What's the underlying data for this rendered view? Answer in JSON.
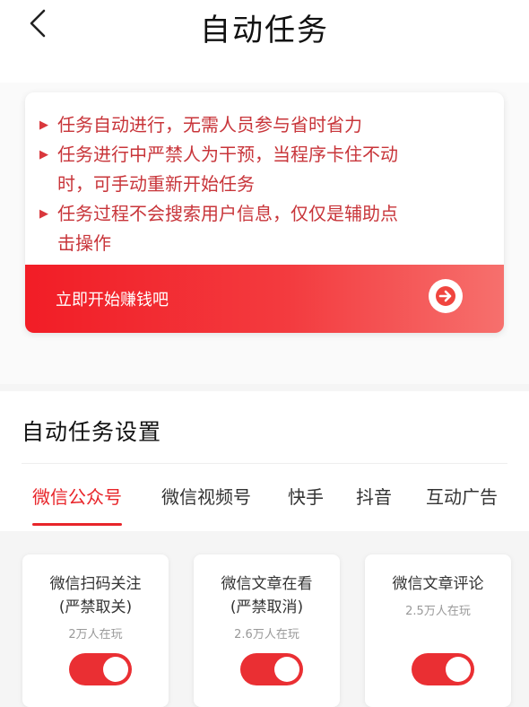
{
  "header": {
    "title": "自动任务",
    "back_icon": "chevron-left-icon"
  },
  "info": {
    "rules": [
      {
        "line1": "任务自动进行，无需人员参与省时省力",
        "line2": ""
      },
      {
        "line1": "任务进行中严禁人为干预，当程序卡住不动",
        "line2": "时，可手动重新开始任务"
      },
      {
        "line1": "任务过程不会搜索用户信息，仅仅是辅助点",
        "line2": "击操作"
      }
    ],
    "bullet_icon": "triangle-right-icon",
    "cta_label": "立即开始赚钱吧",
    "cta_icon": "arrow-right-circle-icon"
  },
  "settings": {
    "title": "自动任务设置",
    "tabs": [
      "微信公众号",
      "微信视频号",
      "快手",
      "抖音",
      "互动广告"
    ],
    "active_tab": "微信公众号"
  },
  "tasks": [
    {
      "title_line1": "微信扫码关注",
      "title_line2": "(严禁取关)",
      "players": "2万人在玩",
      "enabled": true
    },
    {
      "title_line1": "微信文章在看",
      "title_line2": "(严禁取消)",
      "players": "2.6万人在玩",
      "enabled": true
    },
    {
      "title_line1": "微信文章评论",
      "title_line2": "",
      "players": "2.5万人在玩",
      "enabled": true
    }
  ],
  "colors": {
    "accent": "#e8252a",
    "rule_text": "#c8353a",
    "cta_gradient_start": "#f21d26",
    "cta_gradient_end": "#f6706d"
  }
}
